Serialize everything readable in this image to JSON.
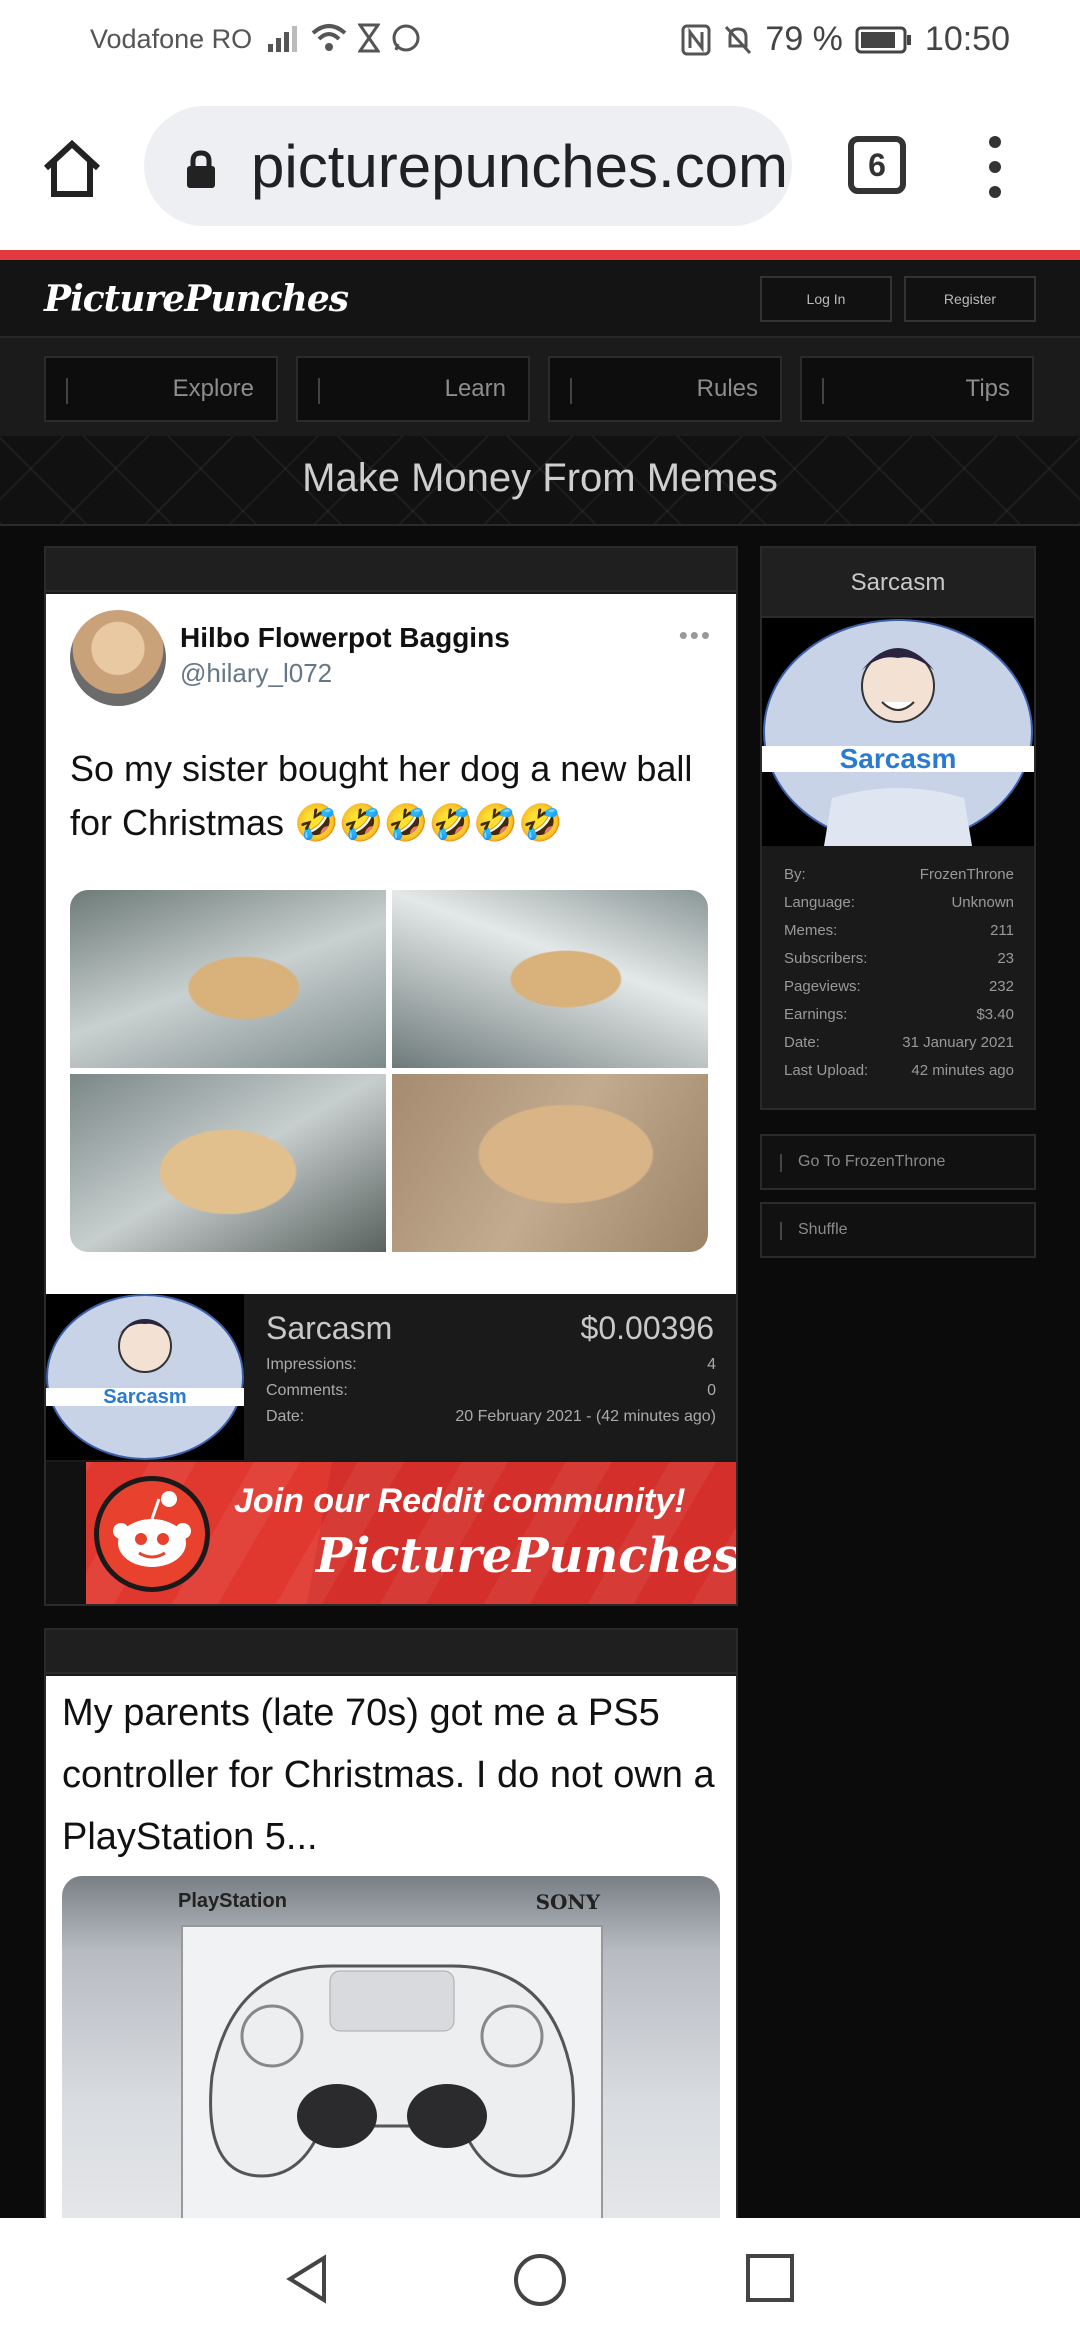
{
  "status_bar": {
    "carrier": "Vodafone RO",
    "battery": "79 %",
    "time": "10:50"
  },
  "browser": {
    "url": "picturepunches.com",
    "tab_count": "6"
  },
  "site": {
    "logo": "PicturePunches",
    "login": "Log In",
    "register": "Register",
    "nav": [
      "Explore",
      "Learn",
      "Rules",
      "Tips"
    ],
    "banner": "Make Money From Memes"
  },
  "post1": {
    "tweet": {
      "name": "Hilbo Flowerpot Baggins",
      "handle": "@hilary_l072",
      "text": "So my sister bought her dog a new ball for Christmas 🤣🤣🤣🤣🤣🤣"
    },
    "title": "Sarcasm",
    "earnings": "$0.00396",
    "stats": [
      {
        "label": "Impressions:",
        "value": "4"
      },
      {
        "label": "Comments:",
        "value": "0"
      },
      {
        "label": "Date:",
        "value": "20 February 2021 - (42 minutes ago)"
      }
    ],
    "avatar_label": "Sarcasm"
  },
  "reddit_banner": {
    "line1": "Join our Reddit community!",
    "line2": "PicturePunches"
  },
  "post2": {
    "text": "My parents (late 70s) got me a PS5 controller for Christmas. I do not own a PlayStation 5...",
    "box_brand": "PlayStation",
    "box_maker": "SONY"
  },
  "sidebar": {
    "title": "Sarcasm",
    "avatar_label": "Sarcasm",
    "stats": [
      {
        "label": "By:",
        "value": "FrozenThrone"
      },
      {
        "label": "Language:",
        "value": "Unknown"
      },
      {
        "label": "Memes:",
        "value": "211"
      },
      {
        "label": "Subscribers:",
        "value": "23"
      },
      {
        "label": "Pageviews:",
        "value": "232"
      },
      {
        "label": "Earnings:",
        "value": "$3.40"
      },
      {
        "label": "Date:",
        "value": "31 January 2021"
      },
      {
        "label": "Last Upload:",
        "value": "42 minutes ago"
      }
    ],
    "goto": "Go To FrozenThrone",
    "shuffle": "Shuffle"
  },
  "colors": {
    "accent_red": "#e03a3e",
    "background": "#0b0b0b",
    "panel": "#1a1a1a"
  }
}
